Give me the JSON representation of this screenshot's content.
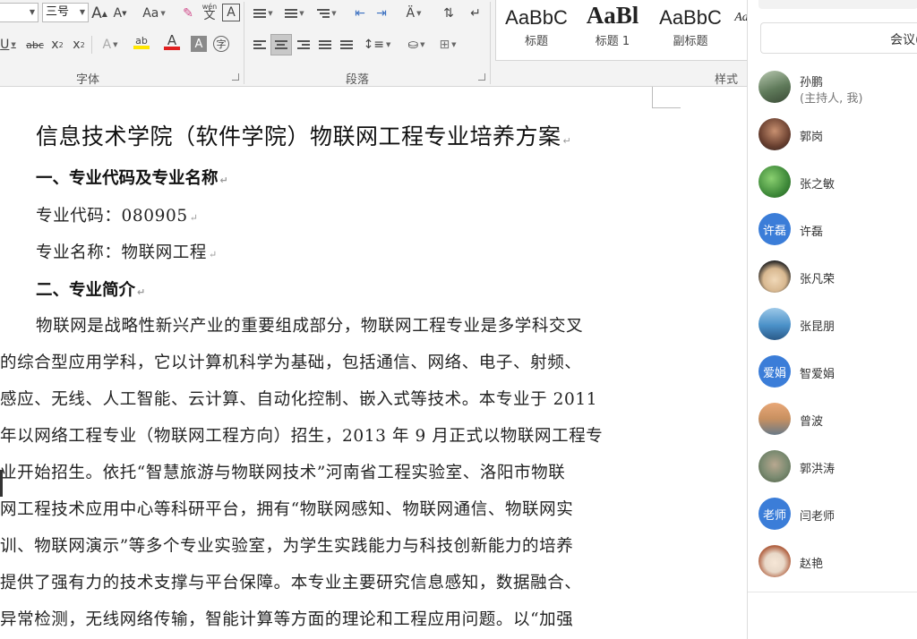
{
  "ribbon": {
    "font_name_value": "",
    "font_size_value": "三号",
    "grow_font_icon": "A",
    "shrink_font_icon": "A",
    "change_case_label": "Aa",
    "phonetic_guide": "wén",
    "phonetic_char": "文",
    "char_border_label": "A",
    "underline_label": "U",
    "strikethrough_label": "abc",
    "subscript_label": "x",
    "superscript_label": "x",
    "text_effects_label": "A",
    "highlight_label": "ab",
    "font_color_label": "A",
    "char_shading_label": "A",
    "enclose_char_label": "字",
    "group_font_label": "字体",
    "group_paragraph_label": "段落",
    "group_styles_label": "样式",
    "styles": [
      {
        "sample": "AaBbC",
        "name": "标题"
      },
      {
        "sample": "AaBl",
        "name": "标题 1"
      },
      {
        "sample": "AaBbC",
        "name": "副标题"
      },
      {
        "sample": "Aa",
        "name": ""
      }
    ],
    "colors": {
      "highlight": "#ffe600",
      "font_color": "#e02020",
      "ribbon_bg": "#f3f3f3"
    }
  },
  "document": {
    "title": "信息技术学院（软件学院）物联网工程专业培养方案",
    "heading1": "一、专业代码及专业名称",
    "code_line": "专业代码：080905",
    "name_line": "专业名称：物联网工程",
    "heading2": "二、专业简介",
    "paragraph_lines": [
      "物联网是战略性新兴产业的重要组成部分，物联网工程专业是多学科交叉",
      "的综合型应用学科，它以计算机科学为基础，包括通信、网络、电子、射频、",
      "感应、无线、人工智能、云计算、自动化控制、嵌入式等技术。本专业于 2011",
      "年以网络工程专业（物联网工程方向）招生，2013 年 9 月正式以物联网工程专",
      "业开始招生。依托“智慧旅游与物联网技术”河南省工程实验室、洛阳市物联",
      "网工程技术应用中心等科研平台，拥有“物联网感知、物联网通信、物联网实",
      "训、物联网演示”等多个专业实验室，为学生实践能力与科技创新能力的培养",
      "提供了强有力的技术支撑与平台保障。本专业主要研究信息感知，数据融合、",
      "异常检测，无线网络传输，智能计算等方面的理论和工程应用问题。以“加强"
    ],
    "para_mark": "↵"
  },
  "panel": {
    "meeting_label": "会议(",
    "participants": [
      {
        "name": "孙鹏",
        "role": "(主持人, 我)",
        "avatar_text": "",
        "avatar_color": "#6b8a6a"
      },
      {
        "name": "郭岗",
        "role": "",
        "avatar_text": "",
        "avatar_color": "#8a5a3a"
      },
      {
        "name": "张之敏",
        "role": "",
        "avatar_text": "",
        "avatar_color": "#3f8a3a"
      },
      {
        "name": "许磊",
        "role": "",
        "avatar_text": "许磊",
        "avatar_color": "#3b7dd8"
      },
      {
        "name": "张凡荣",
        "role": "",
        "avatar_text": "",
        "avatar_color": "#d8b890"
      },
      {
        "name": "张昆朋",
        "role": "",
        "avatar_text": "",
        "avatar_color": "#4a90c8"
      },
      {
        "name": "智爱娟",
        "role": "",
        "avatar_text": "爱娟",
        "avatar_color": "#3b7dd8"
      },
      {
        "name": "曾波",
        "role": "",
        "avatar_text": "",
        "avatar_color": "#c89060"
      },
      {
        "name": "郭洪涛",
        "role": "",
        "avatar_text": "",
        "avatar_color": "#7a8a70"
      },
      {
        "name": "闫老师",
        "role": "",
        "avatar_text": "老师",
        "avatar_color": "#3b7dd8"
      },
      {
        "name": "赵艳",
        "role": "",
        "avatar_text": "",
        "avatar_color": "#e8d8c8"
      }
    ]
  }
}
